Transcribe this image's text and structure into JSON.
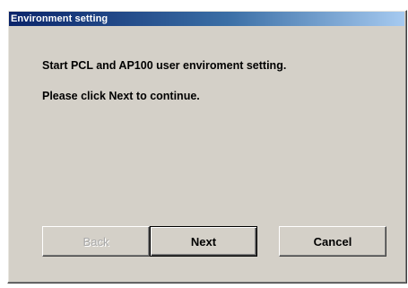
{
  "window": {
    "title": "Environment setting"
  },
  "content": {
    "line1": "Start PCL and AP100 user enviroment setting.",
    "line2": "Please click Next to continue."
  },
  "buttons": {
    "back": "Back",
    "next": "Next",
    "cancel": "Cancel"
  },
  "colors": {
    "titlebar_start": "#0a246a",
    "titlebar_end": "#a6caf0",
    "dialog_face": "#d4d0c8"
  }
}
